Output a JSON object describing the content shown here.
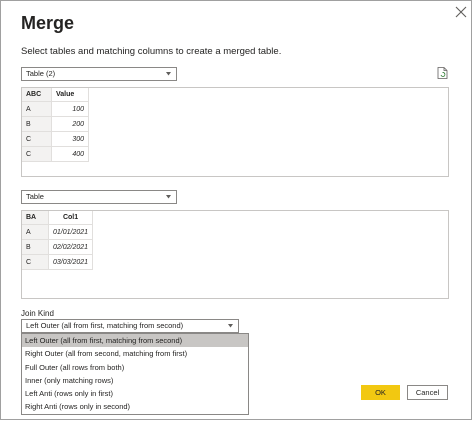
{
  "dialog": {
    "title": "Merge",
    "subtitle": "Select tables and matching columns to create a merged table."
  },
  "first_table": {
    "selected": "Table (2)",
    "columns": [
      "ABC",
      "Value"
    ],
    "rows": [
      [
        "A",
        "100"
      ],
      [
        "B",
        "200"
      ],
      [
        "C",
        "300"
      ],
      [
        "C",
        "400"
      ]
    ]
  },
  "second_table": {
    "selected": "Table",
    "columns": [
      "BA",
      "Col1"
    ],
    "rows": [
      [
        "A",
        "01/01/2021"
      ],
      [
        "B",
        "02/02/2021"
      ],
      [
        "C",
        "03/03/2021"
      ]
    ]
  },
  "join_kind": {
    "label": "Join Kind",
    "selected": "Left Outer (all from first, matching from second)",
    "options": [
      "Left Outer (all from first, matching from second)",
      "Right Outer (all from second, matching from first)",
      "Full Outer (all rows from both)",
      "Inner (only matching rows)",
      "Left Anti (rows only in first)",
      "Right Anti (rows only in second)"
    ]
  },
  "buttons": {
    "ok": "OK",
    "cancel": "Cancel"
  },
  "colors": {
    "accent": "#f2c811",
    "selected_option": "#c8c6c4"
  },
  "icons": {
    "close": "close-icon",
    "dropdown": "chevron-down-icon",
    "preview": "file-refresh-icon"
  }
}
